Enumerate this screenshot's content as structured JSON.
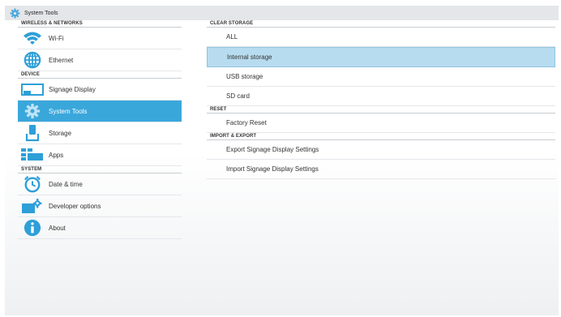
{
  "app": {
    "title": "System Tools",
    "icon": "gear-icon"
  },
  "colors": {
    "selected_left": "#3aa7db",
    "selected_right": "#b8dcef",
    "accent": "#2e9fd8"
  },
  "left": {
    "sections": [
      {
        "header": "WIRELESS & NETWORKS",
        "items": [
          {
            "label": "Wi-Fi",
            "icon": "wifi-icon"
          },
          {
            "label": "Ethernet",
            "icon": "ethernet-icon"
          }
        ]
      },
      {
        "header": "DEVICE",
        "items": [
          {
            "label": "Signage Display",
            "icon": "display-icon"
          },
          {
            "label": "System Tools",
            "icon": "gear-icon",
            "selected": true
          },
          {
            "label": "Storage",
            "icon": "storage-icon"
          },
          {
            "label": "Apps",
            "icon": "apps-icon"
          }
        ]
      },
      {
        "header": "SYSTEM",
        "items": [
          {
            "label": "Date & time",
            "icon": "clock-icon"
          },
          {
            "label": "Developer options",
            "icon": "developer-icon"
          },
          {
            "label": "About",
            "icon": "info-icon"
          }
        ]
      }
    ]
  },
  "right": {
    "sections": [
      {
        "header": "CLEAR STORAGE",
        "items": [
          {
            "label": "ALL"
          },
          {
            "label": "Internal storage",
            "selected": true
          },
          {
            "label": "USB storage"
          },
          {
            "label": "SD card"
          }
        ]
      },
      {
        "header": "RESET",
        "items": [
          {
            "label": "Factory Reset"
          }
        ]
      },
      {
        "header": "IMPORT & EXPORT",
        "items": [
          {
            "label": "Export Signage Display Settings"
          },
          {
            "label": "Import Signage Display Settings"
          }
        ]
      }
    ]
  }
}
